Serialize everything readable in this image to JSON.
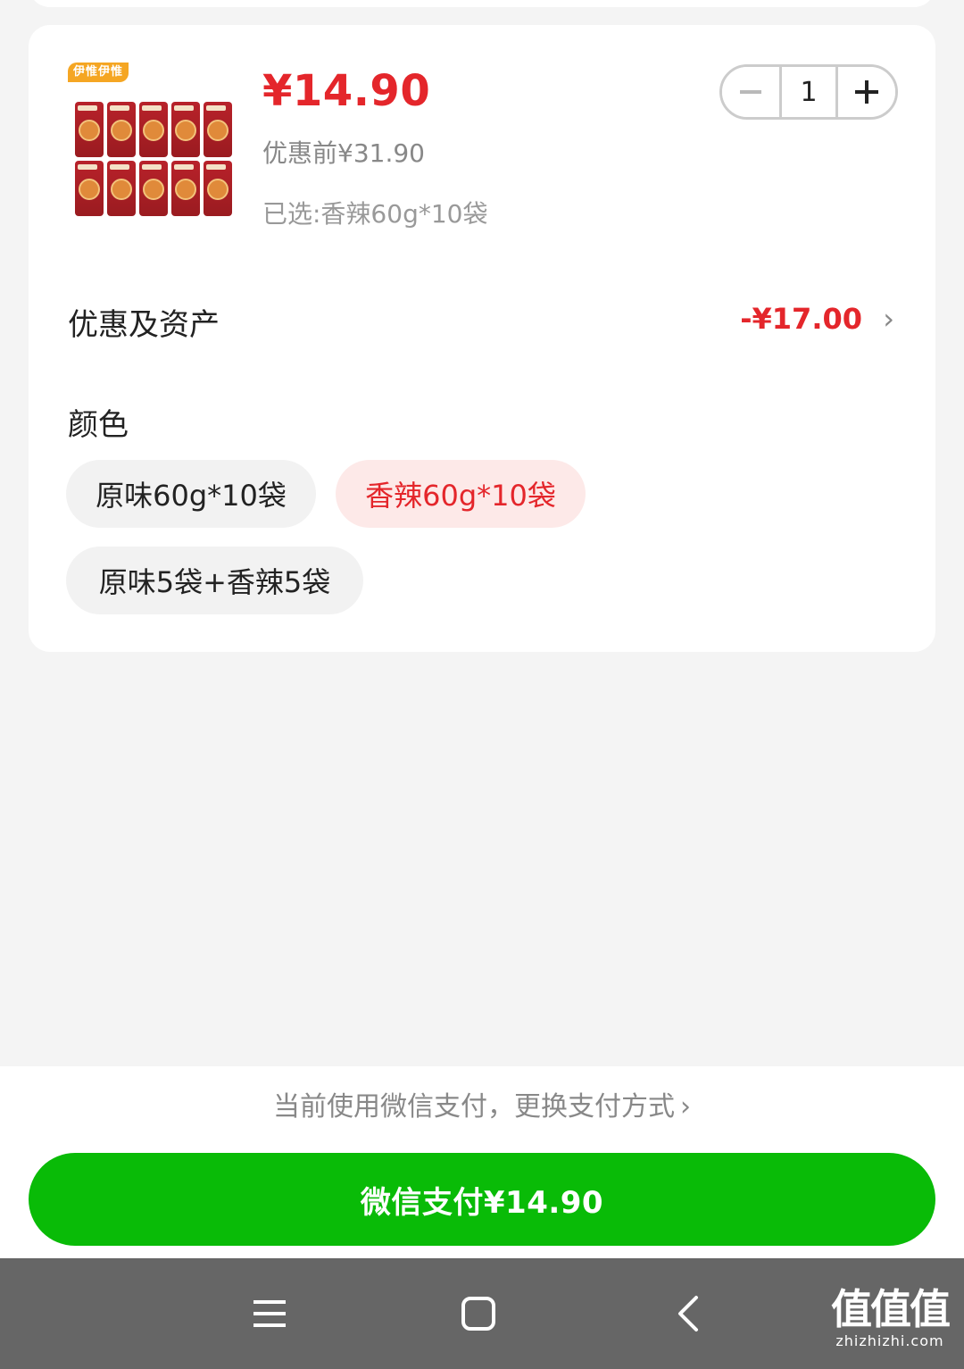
{
  "product": {
    "badge": "伊惟伊惟",
    "price": "¥14.90",
    "original_price": "优惠前¥31.90",
    "selected": "已选:香辣60g*10袋",
    "quantity": "1",
    "minus_icon": "minus-icon",
    "plus_icon": "plus-icon"
  },
  "discount": {
    "label": "优惠及资产",
    "value": "-¥17.00",
    "chevron": "›"
  },
  "color": {
    "title": "颜色",
    "options": [
      {
        "label": "原味60g*10袋",
        "selected": false
      },
      {
        "label": "香辣60g*10袋",
        "selected": true
      },
      {
        "label": "原味5袋+香辣5袋",
        "selected": false
      }
    ]
  },
  "payment": {
    "hint": "当前使用微信支付，更换支付方式",
    "hint_chevron": "›",
    "button_label": "微信支付¥14.90"
  },
  "watermark": {
    "logo": "值值值",
    "url": "zhizhizhi.com"
  },
  "colors": {
    "accent_red": "#e4262b",
    "wechat_green": "#09bb07",
    "nav_bar": "#666666"
  }
}
